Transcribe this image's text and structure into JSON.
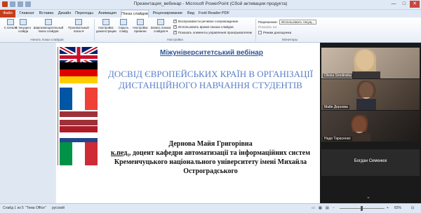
{
  "window": {
    "title": "Презентация_вебинар - Microsoft PowerPoint (Сбой активации продукта)",
    "buttons": [
      "—",
      "□",
      "✕"
    ]
  },
  "tabs": [
    "Файл",
    "Главная",
    "Вставка",
    "Дизайн",
    "Переходы",
    "Анимация",
    "Показ слайдов",
    "Рецензирование",
    "Вид",
    "Foxit Reader PDF"
  ],
  "active_tab": "Показ слайдов",
  "ribbon": {
    "buttons": [
      {
        "label": "С начала"
      },
      {
        "label": "С текущего слайда"
      },
      {
        "label": "Широковещательный показ слайдов"
      },
      {
        "label": "Произвольный показ ▾"
      },
      {
        "label": "Настройка демонстрации"
      },
      {
        "label": "Скрыть слайд"
      },
      {
        "label": "Настройка времени"
      },
      {
        "label": "Запись показа слайдов ▾"
      }
    ],
    "group_labels": [
      "Начать показ слайдов",
      "Настройка",
      "Мониторы"
    ],
    "checkboxes": [
      {
        "label": "Воспроизвести речевое сопровождение",
        "checked": true
      },
      {
        "label": "Использовать время показа слайдов",
        "checked": true
      },
      {
        "label": "Показать элементы управления проигрывателем",
        "checked": true
      }
    ],
    "monitors": {
      "resolution_label": "Разрешение:",
      "resolution_value": "Использовать текущ...",
      "show_on": "Показать на:",
      "presenter_view": "Режим докладчика"
    }
  },
  "slide": {
    "title": "Міжуніверситетський вебінар",
    "heading": "ДОСВІД ЄВРОПЕЙСЬКИХ КРАЇН В ОРГАНІЗАЦІЇ ДИСТАНЦІЙНОГО НАВЧАННЯ СТУДЕНТІВ",
    "author_name": "Дернова Майя Григорівна",
    "author_degree": "к.пед.",
    "author_rest": ", доцент кафедри автоматизації та інформаційних систем Кременчуцького національного університету імені Михайла Остроградського"
  },
  "meeting": {
    "participants": [
      {
        "name": "Olesia Smolinska"
      },
      {
        "name": "Майя Дернова"
      },
      {
        "name": "Надя Тарасенко"
      },
      {
        "name": "Богдан Семенюк"
      }
    ]
  },
  "status": {
    "slide_info": "Слайд 1 из 5",
    "theme": "\"Тема Office\"",
    "language": "русский",
    "zoom": "82%"
  }
}
